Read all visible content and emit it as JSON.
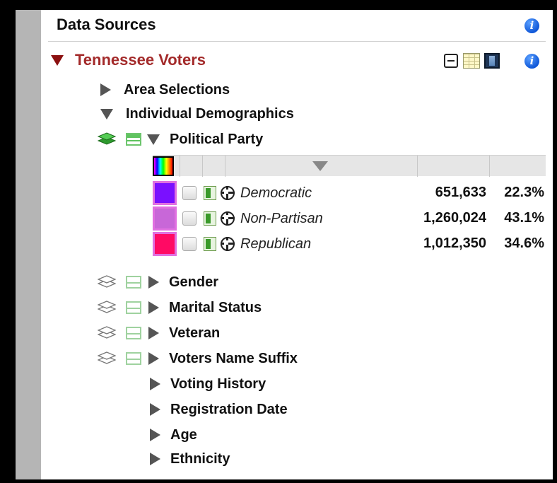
{
  "panel": {
    "title": "Data Sources"
  },
  "source": {
    "name": "Tennessee Voters"
  },
  "tree": {
    "area_selections": "Area Selections",
    "individual_demographics": "Individual Demographics",
    "political_party": "Political Party",
    "collapsed_items": [
      "Gender",
      "Marital Status",
      "Veteran",
      "Voters Name Suffix"
    ],
    "plain_items": [
      "Voting History",
      "Registration Date",
      "Age",
      "Ethnicity"
    ]
  },
  "categories": [
    {
      "name": "Democratic",
      "count": "651,633",
      "percent": "22.3%",
      "color": "#7a10ff"
    },
    {
      "name": "Non-Partisan",
      "count": "1,260,024",
      "percent": "43.1%",
      "color": "#c867d8"
    },
    {
      "name": "Republican",
      "count": "1,012,350",
      "percent": "34.6%",
      "color": "#ff0a64"
    }
  ],
  "icons": {
    "info": "info-icon",
    "collapse": "minus-box-icon",
    "table_view": "grid-icon",
    "film": "film-icon",
    "layers": "layers-icon",
    "target": "crosshair-icon"
  },
  "colors": {
    "source_title": "#a32a2a",
    "active_layer": "#3cbf3c",
    "info_blue": "#1058d8"
  }
}
